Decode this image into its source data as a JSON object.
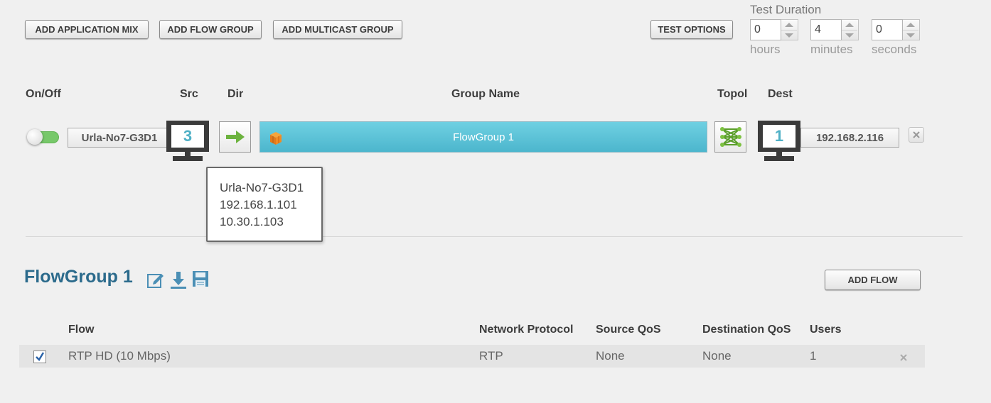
{
  "toolbar": {
    "add_application_mix": "ADD APPLICATION MIX",
    "add_flow_group": "ADD FLOW GROUP",
    "add_multicast_group": "ADD MULTICAST GROUP",
    "test_options": "TEST OPTIONS"
  },
  "test_duration": {
    "label": "Test Duration",
    "hours": {
      "value": "0",
      "unit": "hours"
    },
    "minutes": {
      "value": "4",
      "unit": "minutes"
    },
    "seconds": {
      "value": "0",
      "unit": "seconds"
    }
  },
  "group_table": {
    "headers": {
      "on_off": "On/Off",
      "src": "Src",
      "dir": "Dir",
      "group_name": "Group Name",
      "topol": "Topol",
      "dest": "Dest"
    },
    "row": {
      "enabled": true,
      "src_name": "Urla-No7-G3D1",
      "src_count": "3",
      "group_name": "FlowGroup 1",
      "dest_count": "1",
      "dest_ip": "192.168.2.116"
    }
  },
  "tooltip": {
    "lines": [
      "Urla-No7-G3D1",
      "192.168.1.101",
      "10.30.1.103"
    ]
  },
  "flow_group": {
    "title": "FlowGroup 1",
    "add_flow": "ADD FLOW",
    "headers": {
      "flow": "Flow",
      "network_protocol": "Network Protocol",
      "source_qos": "Source QoS",
      "destination_qos": "Destination QoS",
      "users": "Users"
    },
    "rows": [
      {
        "checked": true,
        "flow": "RTP HD (10 Mbps)",
        "network_protocol": "RTP",
        "source_qos": "None",
        "destination_qos": "None",
        "users": "1"
      }
    ]
  },
  "colors": {
    "group_bar": "#5cc3d8",
    "toggle_on": "#77c86a",
    "title_blue": "#2c6b8c",
    "monitor_number": "#4fb0c6",
    "arrow_green": "#6db33f"
  },
  "icons": {
    "direction": "arrow-right-icon",
    "group": "cube-stack-icon",
    "topology": "mesh-topology-icon",
    "remove": "close-icon",
    "edit": "edit-icon",
    "download": "download-icon",
    "save": "save-icon"
  }
}
